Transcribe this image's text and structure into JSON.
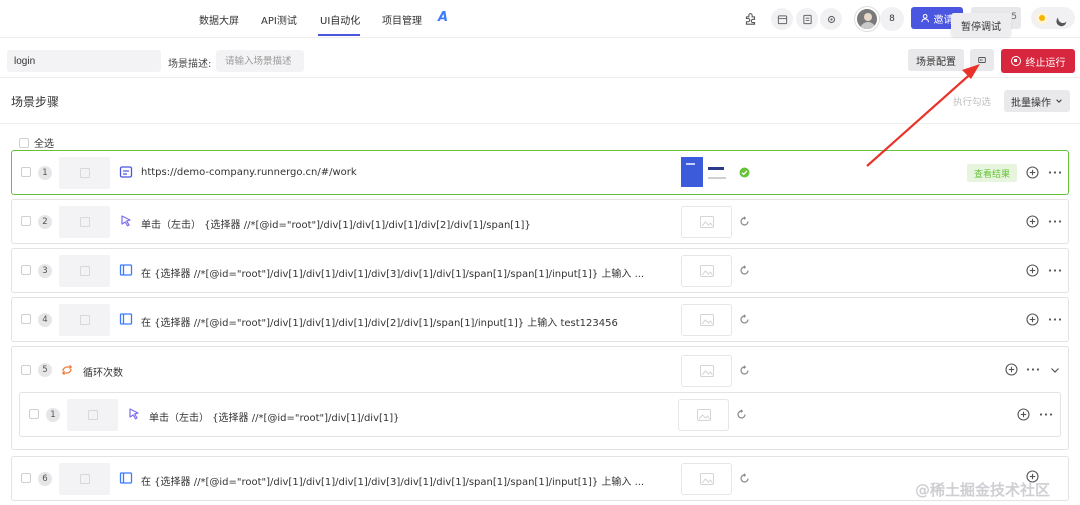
{
  "nav": {
    "tabs": [
      {
        "label": "数据大屏"
      },
      {
        "label": "API测试"
      },
      {
        "label": "UI自动化"
      },
      {
        "label": "项目管理"
      }
    ],
    "ai_logo": "A",
    "member_count": "8",
    "invite_label": "邀请",
    "hidden_badge": "5",
    "tooltip": "暂停调试"
  },
  "scene": {
    "name": "login",
    "desc_label": "场景描述:",
    "desc_placeholder": "请输入场景描述",
    "config_button": "场景配置",
    "stop_button": "终止运行"
  },
  "steps_header": {
    "title": "场景步骤",
    "exec_button": "执行勾选",
    "batch_button": "批量操作",
    "select_all": "全选"
  },
  "steps": [
    {
      "num": "1",
      "text": "https://demo-company.runnergo.cn/#/work",
      "status": "success",
      "result_button": "查看结果"
    },
    {
      "num": "2",
      "text": "单击（左击） {选择器   //*[@id=\"root\"]/div[1]/div[1]/div[1]/div[2]/div[1]/span[1]}",
      "status": "pending"
    },
    {
      "num": "3",
      "text": "在 {选择器   //*[@id=\"root\"]/div[1]/div[1]/div[1]/div[3]/div[1]/div[1]/span[1]/span[1]/input[1]} 上输入 ...",
      "status": "pending"
    },
    {
      "num": "4",
      "text": "在 {选择器   //*[@id=\"root\"]/div[1]/div[1]/div[1]/div[2]/div[1]/span[1]/input[1]} 上输入  test123456",
      "status": "pending"
    },
    {
      "num": "5",
      "text": "循环次数",
      "status": "pending"
    },
    {
      "num": "1",
      "text": "单击（左击） {选择器   //*[@id=\"root\"]/div[1]/div[1]}",
      "status": "pending"
    },
    {
      "num": "6",
      "text": "在 {选择器   //*[@id=\"root\"]/div[1]/div[1]/div[1]/div[3]/div[1]/div[1]/span[1]/span[1]/input[1]} 上输入 ...",
      "status": "pending"
    }
  ],
  "watermark": "@稀土掘金技术社区",
  "colors": {
    "accent": "#4a55e0",
    "stop": "#d7263d",
    "success": "#67c23a",
    "arrow": "#e8332a"
  }
}
